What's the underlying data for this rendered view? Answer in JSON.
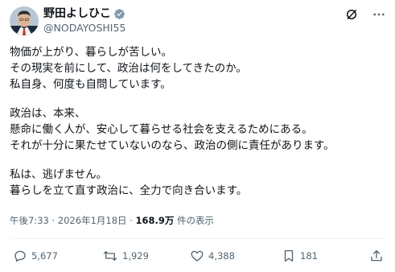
{
  "author": {
    "display_name": "野田よしひこ",
    "handle": "@NODAYOSHI55"
  },
  "tweet": {
    "lines": [
      "物価が上がり、暮らしが苦しい。",
      "その現実を前にして、政治は何をしてきたのか。",
      "私自身、何度も自問しています。",
      "政治は、本来、",
      "懸命に働く人が、安心して暮らせる社会を支えるためにある。",
      "それが十分に果たせていないのなら、政治の側に責任があります。",
      "私は、逃げません。",
      "暮らしを立て直す政治に、全力で向き合います。"
    ]
  },
  "meta": {
    "time": "午後7:33",
    "separator": "·",
    "date": "2026年1月18日",
    "views": "168.9万",
    "views_label": "件の表示"
  },
  "actions": {
    "replies": "5,677",
    "reposts": "1,929",
    "likes": "4,388",
    "bookmarks": "181"
  },
  "icons": {
    "verified": "verified-badge-icon",
    "grok": "grok-icon",
    "more": "more-icon",
    "reply": "reply-icon",
    "repost": "repost-icon",
    "like": "like-icon",
    "bookmark": "bookmark-icon",
    "share": "share-icon"
  },
  "colors": {
    "text": "#0f1419",
    "secondary": "#536471",
    "verified": "#829aab"
  }
}
